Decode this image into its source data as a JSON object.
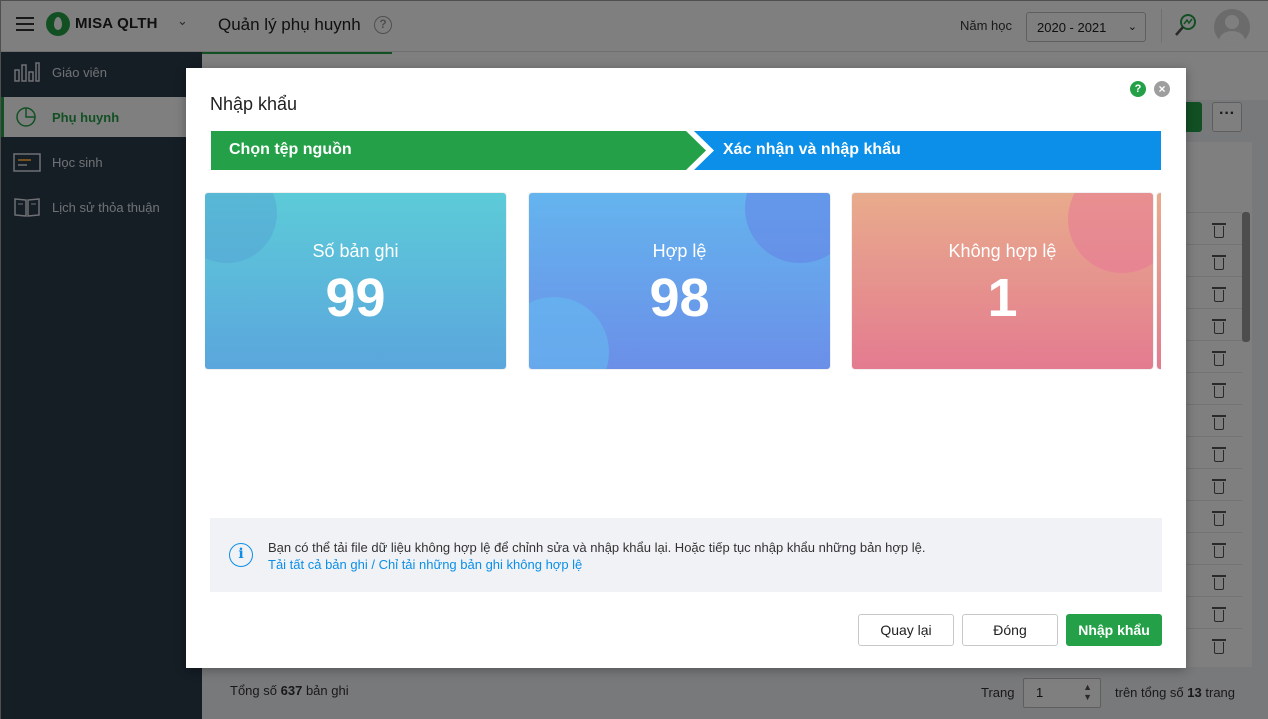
{
  "app": {
    "brand": "MISA QLTH",
    "page_title": "Quản lý phụ huynh",
    "year_label": "Năm học",
    "year_value": "2020 - 2021"
  },
  "sidebar": {
    "items": [
      {
        "label": "Giáo viên",
        "icon": "bar-chart-icon"
      },
      {
        "label": "Phụ huynh",
        "icon": "pie-chart-icon",
        "active": true
      },
      {
        "label": "Học sinh",
        "icon": "id-card-icon"
      },
      {
        "label": "Lịch sử thỏa thuận",
        "icon": "book-icon"
      }
    ]
  },
  "footer": {
    "total_prefix": "Tổng số",
    "total_count": "637",
    "total_suffix": "bản ghi",
    "page_label": "Trang",
    "page_value": "1",
    "page_of_prefix": "trên tổng số",
    "page_total": "13",
    "page_of_suffix": "trang"
  },
  "modal": {
    "title": "Nhập khẩu",
    "steps": [
      "Chọn tệp nguồn",
      "Xác nhận và nhập khẩu"
    ],
    "cards": [
      {
        "label": "Số bản ghi",
        "value": "99"
      },
      {
        "label": "Hợp lệ",
        "value": "98"
      },
      {
        "label": "Không hợp lệ",
        "value": "1"
      }
    ],
    "info_text": "Bạn có thể tải file dữ liệu không hợp lệ để chỉnh sửa và nhập khẩu lại. Hoặc tiếp tục nhập khẩu những bản hợp lệ.",
    "link_all": "Tải tất cả bản ghi",
    "link_sep": " / ",
    "link_invalid": "Chỉ tải những bản ghi không hợp lệ",
    "buttons": {
      "back": "Quay lại",
      "close": "Đóng",
      "import": "Nhập khẩu"
    }
  },
  "colors": {
    "primary_green": "#24a148",
    "step_blue": "#0b8fe8",
    "sidebar_bg": "#2b3a4a"
  }
}
